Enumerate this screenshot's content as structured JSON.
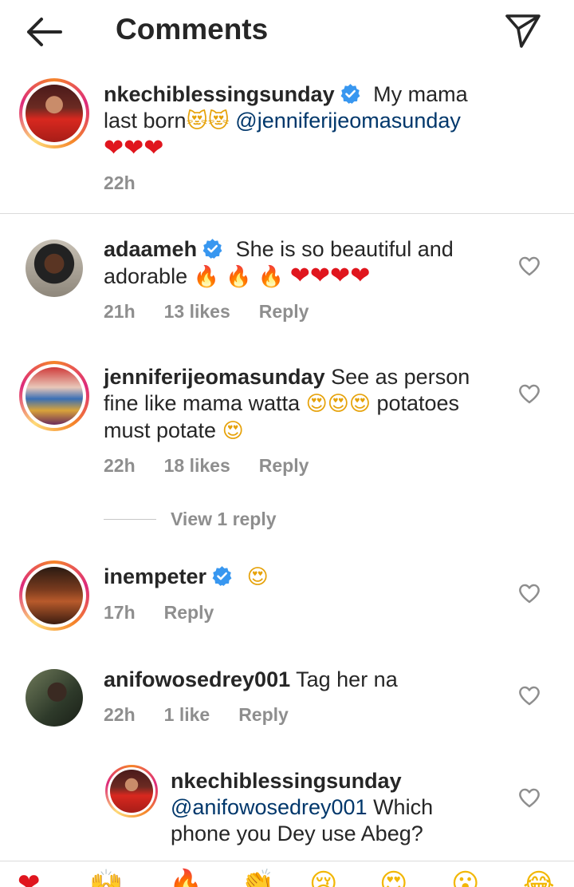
{
  "header": {
    "title": "Comments"
  },
  "icons": {
    "back": "back-arrow-icon",
    "send": "send-icon",
    "like": "heart-outline-icon",
    "verified": "verified-badge-icon"
  },
  "colors": {
    "mention": "#00376b",
    "meta": "#8e8e8e",
    "verified": "#3897f0",
    "heart": "#e0161e"
  },
  "caption": {
    "username": "nkechiblessingsunday",
    "text_a": "My mama",
    "text_b": "last born",
    "emoji_a": "😻😻",
    "mention": "@jenniferijeomasunday",
    "emoji_b": "❤❤❤",
    "time": "22h"
  },
  "comments": [
    {
      "username": "adaameh",
      "text_a": "She is so beautiful and",
      "text_b": "adorable",
      "emoji_fire": "🔥 🔥 🔥",
      "emoji_hearts": "❤❤❤❤",
      "time": "21h",
      "likes": "13 likes",
      "reply": "Reply"
    },
    {
      "username": "jenniferijeomasunday",
      "text_a": "See as person",
      "text_b": "fine like mama watta",
      "emoji_a": "😍😍😍",
      "text_c": "potatoes",
      "text_d": "must potate",
      "emoji_b": "😍",
      "time": "22h",
      "likes": "18 likes",
      "reply": "Reply",
      "view_replies": "View 1 reply"
    },
    {
      "username": "inempeter",
      "emoji_a": "😍",
      "time": "17h",
      "reply": "Reply"
    },
    {
      "username": "anifowosedrey001",
      "text_a": "Tag her na",
      "time": "22h",
      "likes": "1 like",
      "reply": "Reply"
    }
  ],
  "reply": {
    "username": "nkechiblessingsunday",
    "mention": "@anifowosedrey001",
    "text_a": "Which",
    "text_b": "phone you Dey use Abeg?"
  },
  "emoji_bar": [
    "❤",
    "🙌",
    "🔥",
    "👏",
    "😢",
    "😍",
    "😮",
    "😂"
  ]
}
